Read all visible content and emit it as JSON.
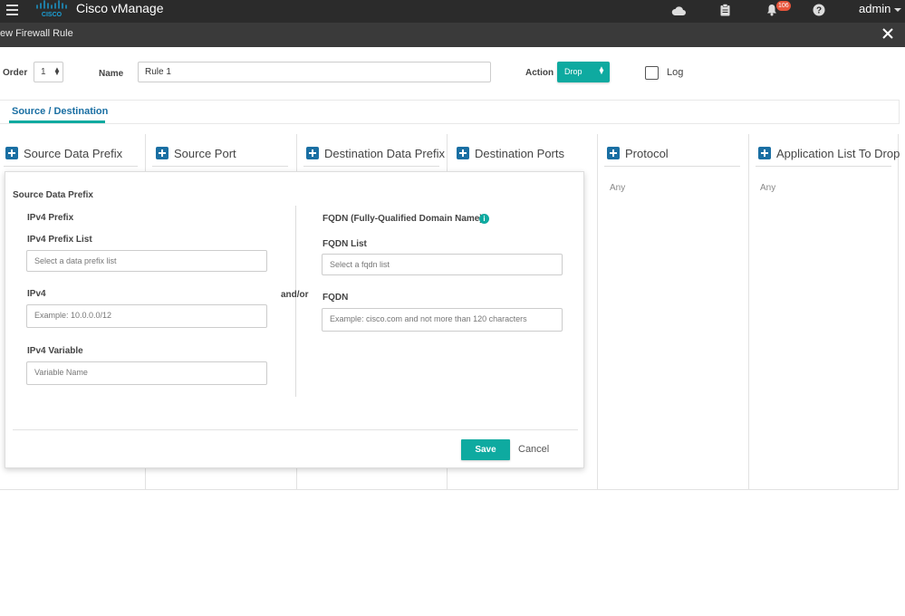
{
  "topbar": {
    "app_title": "Cisco vManage",
    "logo_text": "CISCO",
    "notification_count": "106",
    "user": "admin"
  },
  "modal": {
    "title": "ew Firewall Rule"
  },
  "rule": {
    "order_label": "Order",
    "order_value": "1",
    "name_label": "Name",
    "name_value": "Rule 1",
    "action_label": "Action",
    "action_value": "Drop",
    "log_label": "Log",
    "log_checked": false
  },
  "tabs": [
    {
      "label": "Source / Destination",
      "active": true
    }
  ],
  "columns": [
    {
      "label": "Source Data Prefix",
      "value": ""
    },
    {
      "label": "Source Port",
      "value": ""
    },
    {
      "label": "Destination Data Prefix",
      "value": ""
    },
    {
      "label": "Destination Ports",
      "value": ""
    },
    {
      "label": "Protocol",
      "value": "Any"
    },
    {
      "label": "Application List To Drop",
      "value": "Any"
    }
  ],
  "popover": {
    "title": "Source Data Prefix",
    "left": {
      "section_title": "IPv4 Prefix",
      "prefix_list_label": "IPv4 Prefix List",
      "prefix_list_placeholder": "Select a data prefix list",
      "ipv4_label": "IPv4",
      "ipv4_placeholder": "Example: 10.0.0.0/12",
      "variable_label": "IPv4 Variable",
      "variable_placeholder": "Variable Name"
    },
    "separator": "and/or",
    "right": {
      "section_title": "FQDN (Fully-Qualified Domain Name)",
      "fqdn_list_label": "FQDN List",
      "fqdn_list_placeholder": "Select a fqdn list",
      "fqdn_label": "FQDN",
      "fqdn_placeholder": "Example: cisco.com and not more than 120 characters"
    },
    "save_label": "Save",
    "cancel_label": "Cancel"
  },
  "colors": {
    "accent": "#0eaaa0",
    "brand_blue": "#1a6fa3",
    "topbar_bg": "#2b2b2b",
    "badge": "#e8553b"
  },
  "icons": [
    "hamburger-icon",
    "cisco-logo",
    "cloud-icon",
    "clipboard-icon",
    "bell-icon",
    "help-icon",
    "close-icon",
    "plus-icon",
    "info-icon"
  ]
}
